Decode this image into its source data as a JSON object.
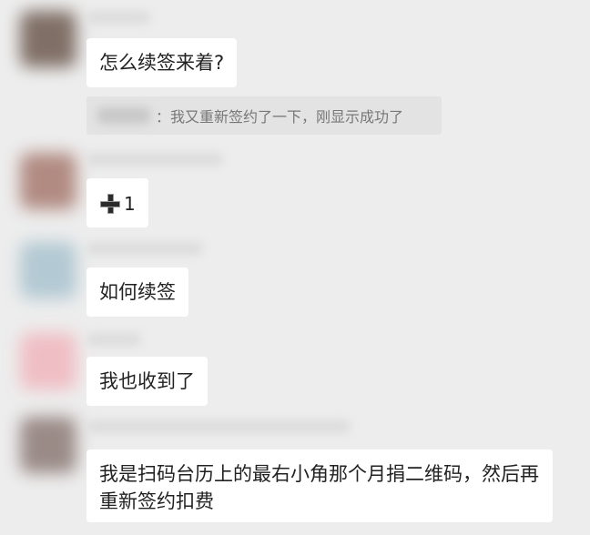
{
  "messages": [
    {
      "text": "怎么续签来着?",
      "avatar_color": "#6e5a50"
    },
    {
      "quote": {
        "text": "：我又重新签约了一下，刚显示成功了"
      }
    },
    {
      "text_count": "1",
      "reaction_icon": "plus-icon",
      "avatar_color": "#a77a70"
    },
    {
      "text": "如何续签",
      "avatar_color": "#a9c3cf"
    },
    {
      "text": "我也收到了",
      "avatar_color": "#f0b6bd"
    },
    {
      "text": "我是扫码台历上的最右小角那个月捐二维码，然后再重新签约扣费",
      "avatar_color": "#8c7a76"
    }
  ]
}
